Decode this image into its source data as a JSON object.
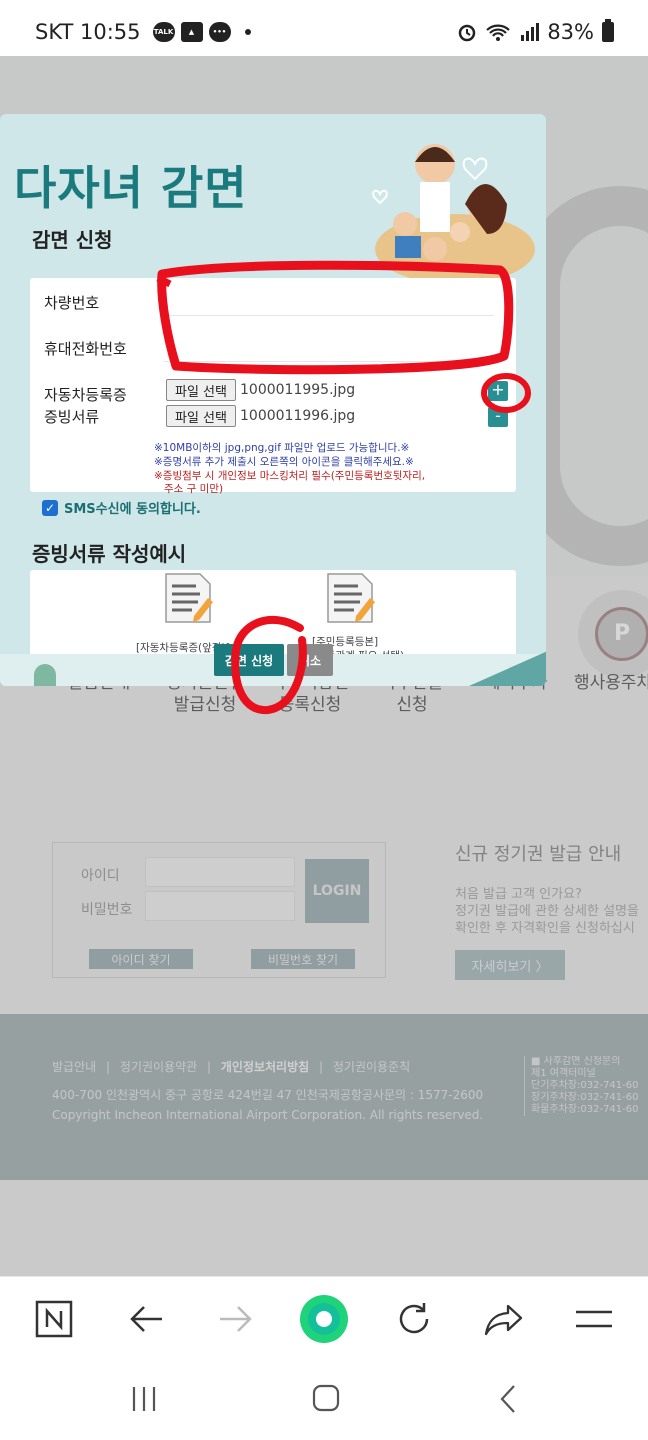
{
  "status_bar": {
    "carrier_time": "SKT 10:55",
    "notif_icons": [
      "talk-icon",
      "gallery-icon",
      "chat-icon"
    ],
    "battery": "83%"
  },
  "modal": {
    "banner_title": "다자녀 감면",
    "section_apply": "감면 신청",
    "fields": {
      "car_number_label": "차량번호",
      "phone_label": "휴대전화번호",
      "doc_label_line1": "자동차등록증",
      "doc_label_line2": "증빙서류"
    },
    "files": [
      {
        "button": "파일 선택",
        "name": "1000011995.jpg",
        "action": "+"
      },
      {
        "button": "파일 선택",
        "name": "1000011996.jpg",
        "action": "-"
      }
    ],
    "notes": [
      "※10MB이하의 jpg,png,gif 파일만 업로드 가능합니다.※",
      "※증명서류 추가 제출시 오른쪽의 아이콘을 클릭해주세요.※",
      "※증빙첨부 시 개인정보 마스킹처리 필수(주민등록번호뒷자리,",
      "주소 구 미만)"
    ],
    "sms_consent": "SMS수신에 동의합니다.",
    "section_example": "증빙서류 작성예시",
    "example_captions": [
      "[자동차등록증(앞장)]",
      "[주민등록등본]",
      "(가족관계 필요 선택)"
    ],
    "apply_button": "감면 신청",
    "cancel_button": "취소"
  },
  "background_page": {
    "menu": [
      {
        "line1": "발급안내",
        "line2": ""
      },
      {
        "line1": "정기권신규",
        "line2": "발급신청"
      },
      {
        "line1": "다자녀감면",
        "line2": "등록신청"
      },
      {
        "line1": "사후환불",
        "line2": "신청"
      },
      {
        "line1": "예약주차",
        "line2": ""
      },
      {
        "line1": "행사용주차",
        "line2": ""
      }
    ],
    "vip_label": "P",
    "login": {
      "id_label": "아이디",
      "pw_label": "비밀번호",
      "login_button": "LOGIN",
      "find_id": "아이디 찾기",
      "find_pw": "비밀번호 찾기"
    },
    "new_guide": {
      "title": "신규 정기권 발급 안내",
      "line1": "처음 발급 고객 인가요?",
      "line2": "정기권 발급에 관한 상세한 설명을",
      "line3": "확인한 후 자격확인을 신청하십시",
      "more_button": "자세히보기 〉"
    },
    "footer": {
      "link1": "발급안내",
      "link2": "정기권이용약관",
      "link3": "개인정보처리방침",
      "link4": "정기권이용준칙",
      "address": "400-700 인천광역시 중구 공항로 424번길 47 인천국제공항공사문의 : 1577-2600",
      "copyright": "Copyright Incheon International Airport Corporation. All rights reserved.",
      "right_line1": "■ 사후감면 신청문의",
      "right_line2": "제1 여객터미널",
      "right_line3": "단기주차장:032-741-60",
      "right_line4": "장기주차장:032-741-60",
      "right_line5": "화물주차장:032-741-60"
    }
  },
  "browser_toolbar": {
    "icons": [
      "naver-n-icon",
      "back-arrow-icon",
      "forward-arrow-icon",
      "home-circle-icon",
      "refresh-icon",
      "share-icon",
      "menu-icon"
    ],
    "accent_color": "#1fd37a"
  },
  "colors": {
    "brand_teal": "#1b7a7d",
    "annotation_red": "#e8101c"
  }
}
